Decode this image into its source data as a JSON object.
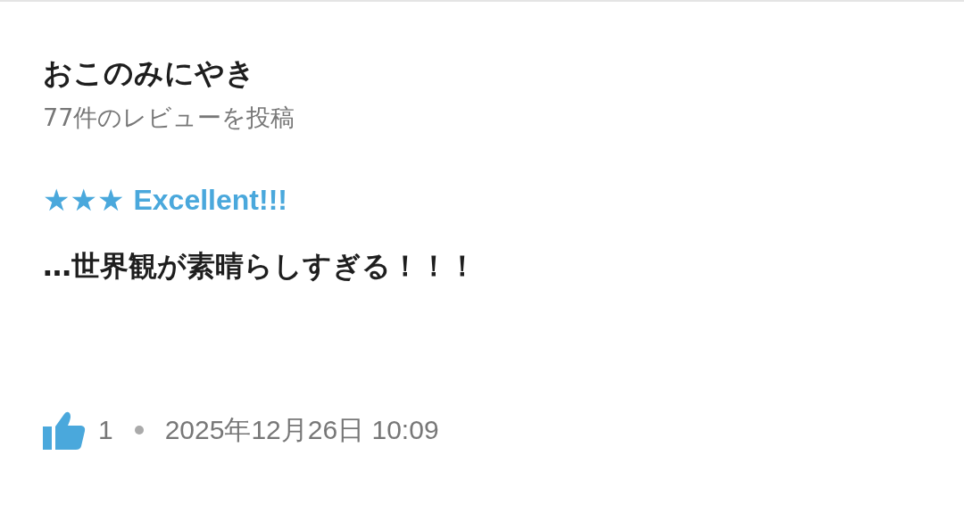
{
  "review": {
    "author": "おこのみにやき",
    "author_meta": "77件のレビューを投稿",
    "stars": 3,
    "headline": "Excellent!!!",
    "body": "…世界観が素晴らしすぎる！！！",
    "likes": "1",
    "date": "2025年12月26日 10:09"
  }
}
